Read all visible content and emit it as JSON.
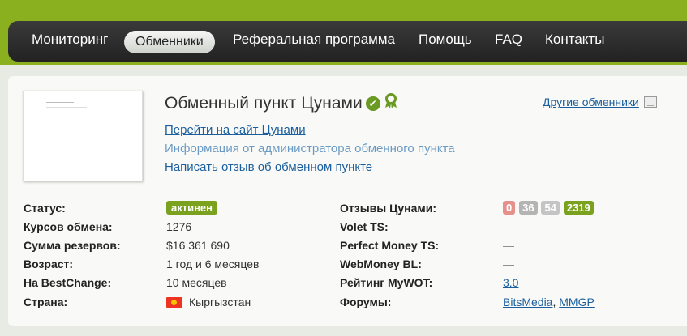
{
  "nav": {
    "items": [
      "Мониторинг",
      "Обменники",
      "Реферальная программа",
      "Помощь",
      "FAQ",
      "Контакты"
    ],
    "active_index": 1
  },
  "exchanger": {
    "title": "Обменный пункт Цунами",
    "verified_icon": "check-circle-icon",
    "award_icon": "award-ribbon-icon",
    "links": {
      "go_to_site": "Перейти на сайт Цунами",
      "admin_info": "Информация от администратора обменного пункта",
      "write_review": "Написать отзыв об обменном пункте"
    },
    "other_exchangers": "Другие обменники"
  },
  "details_left": {
    "status_label": "Статус:",
    "status_value": "активен",
    "rates_label": "Курсов обмена:",
    "rates_value": "1276",
    "reserves_label": "Сумма резервов:",
    "reserves_value": "$16 361 690",
    "age_label": "Возраст:",
    "age_value": "1 год и 6 месяцев",
    "bestchange_label": "На BestChange:",
    "bestchange_value": "10 месяцев",
    "country_label": "Страна:",
    "country_value": "Кыргызстан"
  },
  "details_right": {
    "reviews_label": "Отзывы Цунами:",
    "reviews": [
      "0",
      "36",
      "54",
      "2319"
    ],
    "volet_label": "Volet TS:",
    "volet_value": "—",
    "pm_label": "Perfect Money TS:",
    "pm_value": "—",
    "wm_label": "WebMoney BL:",
    "wm_value": "—",
    "mywot_label": "Рейтинг MyWOT:",
    "mywot_value": "3.0",
    "forums_label": "Форумы:",
    "forums": [
      "BitsMedia",
      "MMGP"
    ],
    "forums_separator": ", "
  },
  "colors": {
    "brand_green": "#8ab01f",
    "status_green": "#7aa21e",
    "link_blue": "#1a5e9e",
    "negative_red": "#e6908c"
  }
}
